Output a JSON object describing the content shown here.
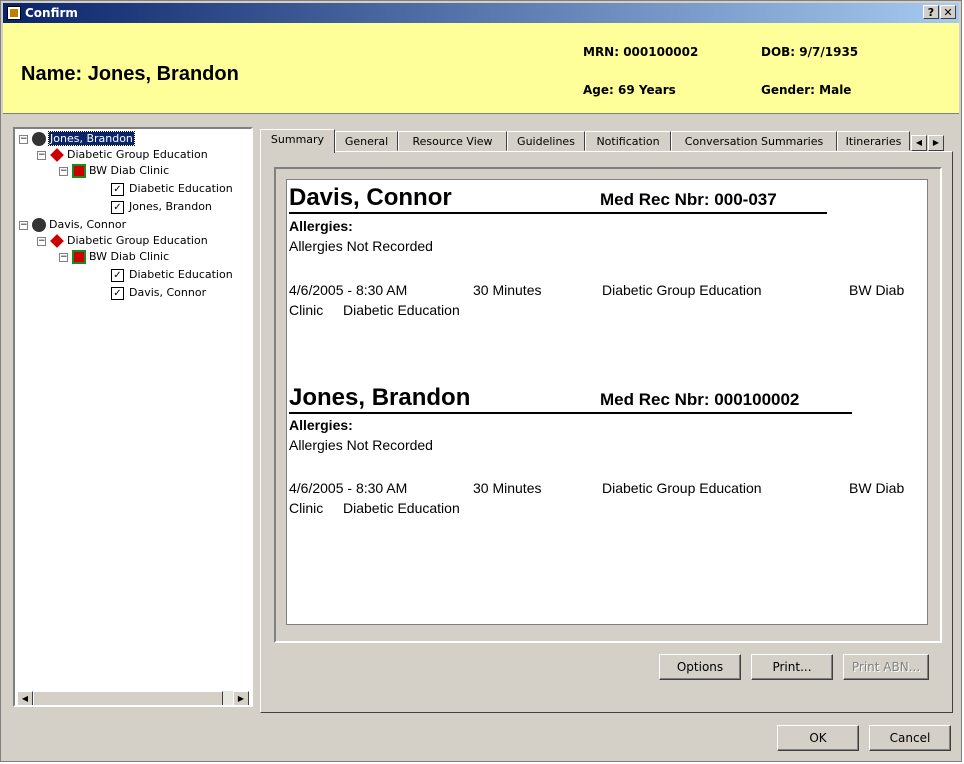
{
  "window": {
    "title": "Confirm"
  },
  "header": {
    "name": "Name: Jones, Brandon",
    "mrn": "MRN: 000100002",
    "dob": "DOB: 9/7/1935",
    "age": "Age:  69 Years",
    "gender": "Gender: Male"
  },
  "tree": [
    {
      "label": "Jones, Brandon",
      "icon": "person-icon",
      "selected": true
    },
    {
      "label": "Diabetic Group Education",
      "icon": "education-icon"
    },
    {
      "label": "BW Diab Clinic",
      "icon": "clinic-icon"
    },
    {
      "label": "Diabetic Education",
      "checked": true
    },
    {
      "label": "Jones, Brandon",
      "checked": true
    },
    {
      "label": "Davis, Connor",
      "icon": "person-icon"
    },
    {
      "label": "Diabetic Group Education",
      "icon": "education-icon"
    },
    {
      "label": "BW Diab Clinic",
      "icon": "clinic-icon"
    },
    {
      "label": "Diabetic Education",
      "checked": true
    },
    {
      "label": "Davis, Connor",
      "checked": true
    }
  ],
  "tabs": [
    "Summary",
    "General",
    "Resource View",
    "Guidelines",
    "Notification",
    "Conversation Summaries",
    "Itineraries"
  ],
  "summary": [
    {
      "name": "Davis, Connor",
      "medrec": "Med Rec Nbr: 000-037",
      "allergies_label": "Allergies:",
      "allergies": "Allergies Not Recorded",
      "appt_datetime": "4/6/2005 - 8:30 AM",
      "duration": "30 Minutes",
      "appt_type": "Diabetic Group Education",
      "location": "BW Diab",
      "location2": "Clinic",
      "resource": "Diabetic Education"
    },
    {
      "name": "Jones, Brandon",
      "medrec": "Med Rec Nbr: 000100002",
      "allergies_label": "Allergies:",
      "allergies": "Allergies Not Recorded",
      "appt_datetime": "4/6/2005 - 8:30 AM",
      "duration": "30 Minutes",
      "appt_type": "Diabetic Group Education",
      "location": "BW Diab",
      "location2": "Clinic",
      "resource": "Diabetic Education"
    }
  ],
  "buttons": {
    "options": "Options",
    "print": "Print...",
    "print_abn": "Print ABN...",
    "ok": "OK",
    "cancel": "Cancel"
  },
  "titlebar_buttons": {
    "help": "?",
    "close": "✕"
  }
}
